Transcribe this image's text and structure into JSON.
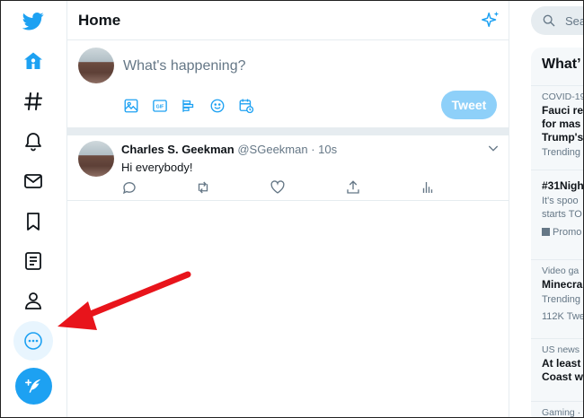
{
  "nav": {
    "items": [
      {
        "name": "twitter-logo-icon"
      },
      {
        "name": "home-icon"
      },
      {
        "name": "explore-hashtag-icon"
      },
      {
        "name": "notifications-bell-icon"
      },
      {
        "name": "messages-envelope-icon"
      },
      {
        "name": "bookmarks-icon"
      },
      {
        "name": "lists-icon"
      },
      {
        "name": "profile-icon"
      },
      {
        "name": "more-icon"
      }
    ],
    "accent": "#1da1f2"
  },
  "header": {
    "title": "Home"
  },
  "compose": {
    "placeholder": "What's happening?",
    "tweet_label": "Tweet",
    "gif_label": "GIF"
  },
  "tweet": {
    "name": "Charles S. Geekman",
    "handle": "@SGeekman",
    "time": "· 10s",
    "text": "Hi everybody!"
  },
  "search": {
    "placeholder": "Sea"
  },
  "trends": {
    "title": "What’",
    "items": [
      {
        "context": "COVID-19",
        "lines": [
          "Fauci re",
          "for mas",
          "Trump's"
        ],
        "sub": "Trending"
      },
      {
        "context": "",
        "lines": [
          "#31Nigh"
        ],
        "sub_lines": [
          "It's spoo",
          "starts TO"
        ],
        "promo": "Promo"
      },
      {
        "context": "Video ga",
        "lines": [
          "Minecra"
        ],
        "sub_lines": [
          "Trending",
          "112K Twe"
        ]
      },
      {
        "context": "US news ·",
        "lines": [
          "At least",
          "Coast w"
        ]
      },
      {
        "context": "Gaming ·",
        "lines": []
      }
    ]
  }
}
